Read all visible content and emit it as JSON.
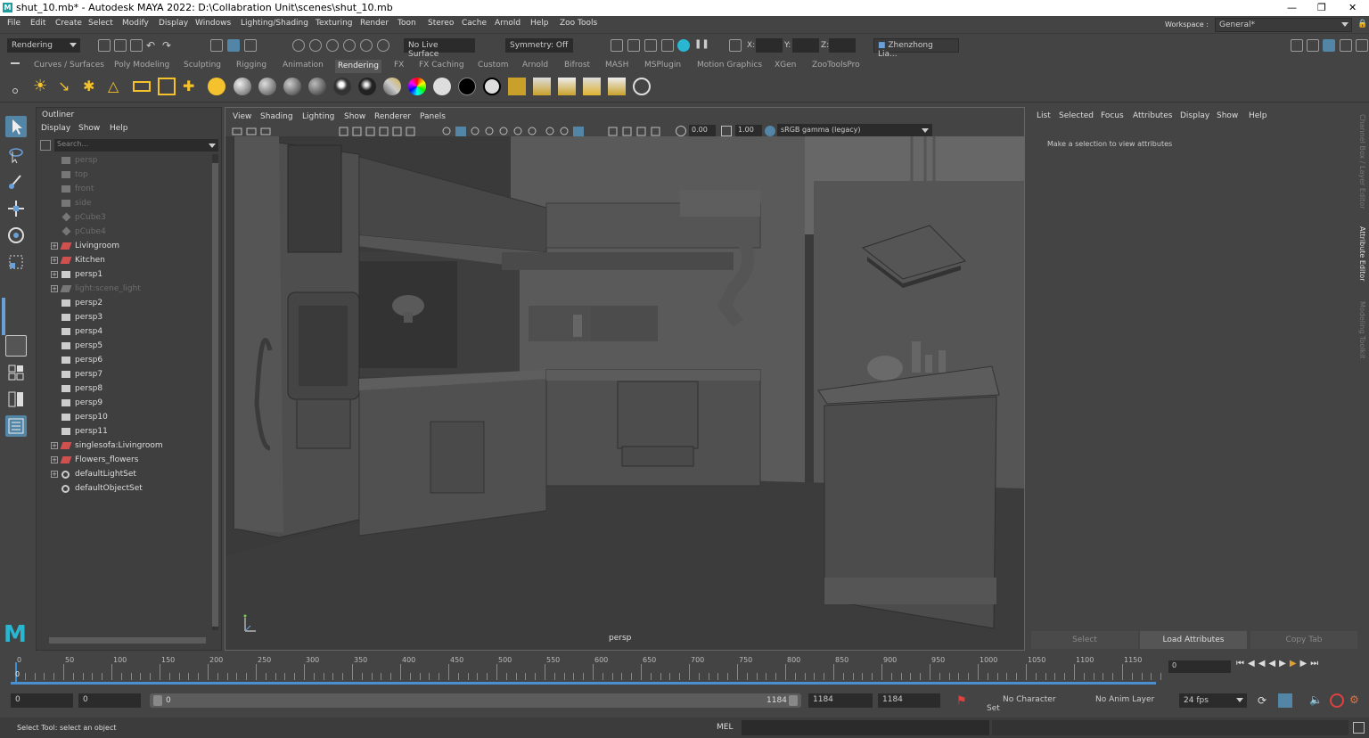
{
  "window": {
    "title": "shut_10.mb* - Autodesk MAYA 2022: D:\\Collabration Unit\\scenes\\shut_10.mb",
    "logo": "M",
    "controls": [
      "—",
      "❐",
      "✕"
    ]
  },
  "menubar": {
    "items": [
      "File",
      "Edit",
      "Create",
      "Select",
      "Modify",
      "Display",
      "Windows",
      "Lighting/Shading",
      "Texturing",
      "Render",
      "Toon",
      "Stereo",
      "Cache",
      "Arnold",
      "Help",
      "Zoo Tools"
    ],
    "workspace_label": "Workspace :",
    "workspace_value": "General*"
  },
  "toolbar": {
    "menuset": "Rendering",
    "live_surface": "No Live Surface",
    "symmetry": "Symmetry: Off",
    "x_label": "X:",
    "y_label": "Y:",
    "z_label": "Z:",
    "user": "Zhenzhong Lia..."
  },
  "shelf": {
    "tabs": [
      "Curves / Surfaces",
      "Poly Modeling",
      "Sculpting",
      "Rigging",
      "Animation",
      "Rendering",
      "FX",
      "FX Caching",
      "Custom",
      "Arnold",
      "Bifrost",
      "MASH",
      "MSPlugin",
      "Motion Graphics",
      "XGen",
      "ZooToolsPro"
    ],
    "active_tab": "Rendering"
  },
  "outliner": {
    "title": "Outliner",
    "menus": [
      "Display",
      "Show",
      "Help"
    ],
    "search_placeholder": "Search...",
    "items": [
      {
        "label": "persp",
        "icon": "camera-icon",
        "dim": true,
        "expand": false
      },
      {
        "label": "top",
        "icon": "camera-icon",
        "dim": true,
        "expand": false
      },
      {
        "label": "front",
        "icon": "camera-icon",
        "dim": true,
        "expand": false
      },
      {
        "label": "side",
        "icon": "camera-icon",
        "dim": true,
        "expand": false
      },
      {
        "label": "pCube3",
        "icon": "mesh-icon",
        "dim": true,
        "expand": false
      },
      {
        "label": "pCube4",
        "icon": "mesh-icon",
        "dim": true,
        "expand": false
      },
      {
        "label": "Livingroom",
        "icon": "group-icon",
        "dim": false,
        "expand": true
      },
      {
        "label": "Kitchen",
        "icon": "group-icon",
        "dim": false,
        "expand": true
      },
      {
        "label": "persp1",
        "icon": "camera-icon",
        "dim": false,
        "expand": true
      },
      {
        "label": "light:scene_light",
        "icon": "group-icon",
        "dim": true,
        "expand": true
      },
      {
        "label": "persp2",
        "icon": "camera-icon",
        "dim": false,
        "expand": false
      },
      {
        "label": "persp3",
        "icon": "camera-icon",
        "dim": false,
        "expand": false
      },
      {
        "label": "persp4",
        "icon": "camera-icon",
        "dim": false,
        "expand": false
      },
      {
        "label": "persp5",
        "icon": "camera-icon",
        "dim": false,
        "expand": false
      },
      {
        "label": "persp6",
        "icon": "camera-icon",
        "dim": false,
        "expand": false
      },
      {
        "label": "persp7",
        "icon": "camera-icon",
        "dim": false,
        "expand": false
      },
      {
        "label": "persp8",
        "icon": "camera-icon",
        "dim": false,
        "expand": false
      },
      {
        "label": "persp9",
        "icon": "camera-icon",
        "dim": false,
        "expand": false
      },
      {
        "label": "persp10",
        "icon": "camera-icon",
        "dim": false,
        "expand": false
      },
      {
        "label": "persp11",
        "icon": "camera-icon",
        "dim": false,
        "expand": false
      },
      {
        "label": "singlesofa:Livingroom",
        "icon": "group-icon",
        "dim": false,
        "expand": true
      },
      {
        "label": "Flowers_flowers",
        "icon": "group-icon",
        "dim": false,
        "expand": true
      },
      {
        "label": "defaultLightSet",
        "icon": "set-icon",
        "dim": false,
        "expand": true
      },
      {
        "label": "defaultObjectSet",
        "icon": "set-icon",
        "dim": false,
        "expand": false
      }
    ]
  },
  "viewport": {
    "menus": [
      "View",
      "Shading",
      "Lighting",
      "Show",
      "Renderer",
      "Panels"
    ],
    "exposure": "0.00",
    "gamma": "1.00",
    "color_space": "sRGB gamma (legacy)",
    "camera_label": "persp"
  },
  "attribute_editor": {
    "menus": [
      "List",
      "Selected",
      "Focus",
      "Attributes",
      "Display",
      "Show",
      "Help"
    ],
    "message": "Make a selection to view attributes",
    "buttons": [
      "Select",
      "Load Attributes",
      "Copy Tab"
    ]
  },
  "side_tabs": [
    "Channel Box / Layer Editor",
    "Attribute Editor",
    "Modeling Toolkit"
  ],
  "timeline": {
    "labels": [
      "0",
      "50",
      "100",
      "150",
      "200",
      "250",
      "300",
      "350",
      "400",
      "450",
      "500",
      "550",
      "600",
      "650",
      "700",
      "750",
      "800",
      "850",
      "900",
      "950",
      "1000",
      "1050",
      "1100",
      "1150"
    ],
    "current_frame": "0",
    "current_frame_field": "0"
  },
  "range": {
    "start": "0",
    "anim_start": "0",
    "slider_start": "0",
    "slider_end": "1184",
    "anim_end": "1184",
    "end": "1184",
    "character_set": "No Character Set",
    "anim_layer": "No Anim Layer",
    "fps": "24 fps"
  },
  "command_line": {
    "help": "Select Tool: select an object",
    "language": "MEL"
  },
  "colors": {
    "accent": "#5285a6",
    "timeline_bar": "#4a8fcf",
    "group_icon": "#d05050"
  }
}
